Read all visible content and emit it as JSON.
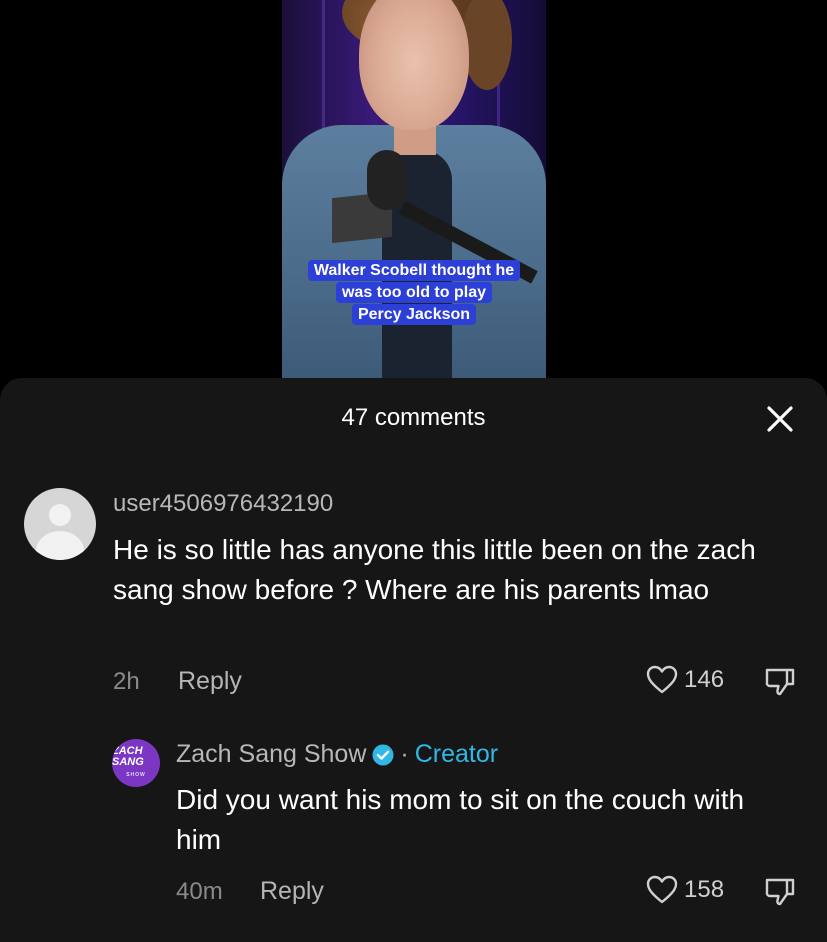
{
  "video": {
    "caption_lines": [
      "Walker Scobell thought he",
      "was too old to play",
      "Percy Jackson"
    ]
  },
  "comments_panel": {
    "title": "47 comments",
    "close_icon": "close-icon"
  },
  "comments": [
    {
      "username": "user4506976432190",
      "text": "He is so little has anyone this little been on the zach sang show before ? Where are his parents lmao",
      "time": "2h",
      "reply_label": "Reply",
      "likes": "146"
    }
  ],
  "replies": [
    {
      "author": "Zach Sang Show",
      "separator": "·",
      "badge": "Creator",
      "avatar_text": "ZACH SANG",
      "avatar_sub": "SHOW",
      "text": "Did you want his mom to sit on the couch with him",
      "time": "40m",
      "reply_label": "Reply",
      "likes": "158"
    }
  ],
  "colors": {
    "sheet_bg": "#161616",
    "creator_accent": "#2fb8e6",
    "caption_bg": "#2c3fd6",
    "creator_avatar": "#7b36c4"
  }
}
